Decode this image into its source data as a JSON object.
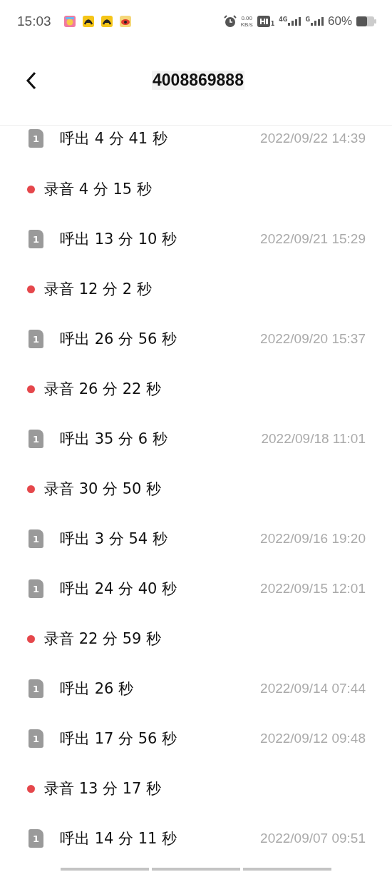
{
  "status_bar": {
    "time": "15:03",
    "speed_value": "0.00",
    "speed_unit": "KB/s",
    "hd_sim": "1",
    "network_1": "4G",
    "network_2": "G",
    "battery": "60%"
  },
  "header": {
    "title": "4008869888"
  },
  "entries": [
    {
      "kind": "call",
      "sim": "1",
      "label": "呼出 4 分 41 秒",
      "date": "2022/09/22 14:39"
    },
    {
      "kind": "recording",
      "label": "录音 4 分 15 秒"
    },
    {
      "kind": "call",
      "sim": "1",
      "label": "呼出 13 分 10 秒",
      "date": "2022/09/21 15:29"
    },
    {
      "kind": "recording",
      "label": "录音 12 分 2 秒"
    },
    {
      "kind": "call",
      "sim": "1",
      "label": "呼出 26 分 56 秒",
      "date": "2022/09/20 15:37"
    },
    {
      "kind": "recording",
      "label": "录音 26 分 22 秒"
    },
    {
      "kind": "call",
      "sim": "1",
      "label": "呼出 35 分 6 秒",
      "date": "2022/09/18 11:01"
    },
    {
      "kind": "recording",
      "label": "录音 30 分 50 秒"
    },
    {
      "kind": "call",
      "sim": "1",
      "label": "呼出 3 分 54 秒",
      "date": "2022/09/16 19:20"
    },
    {
      "kind": "call",
      "sim": "1",
      "label": "呼出 24 分 40 秒",
      "date": "2022/09/15 12:01"
    },
    {
      "kind": "recording",
      "label": "录音 22 分 59 秒"
    },
    {
      "kind": "call",
      "sim": "1",
      "label": "呼出 26 秒",
      "date": "2022/09/14 07:44"
    },
    {
      "kind": "call",
      "sim": "1",
      "label": "呼出 17 分 56 秒",
      "date": "2022/09/12 09:48"
    },
    {
      "kind": "recording",
      "label": "录音 13 分 17 秒"
    },
    {
      "kind": "call",
      "sim": "1",
      "label": "呼出 14 分 11 秒",
      "date": "2022/09/07 09:51"
    }
  ]
}
